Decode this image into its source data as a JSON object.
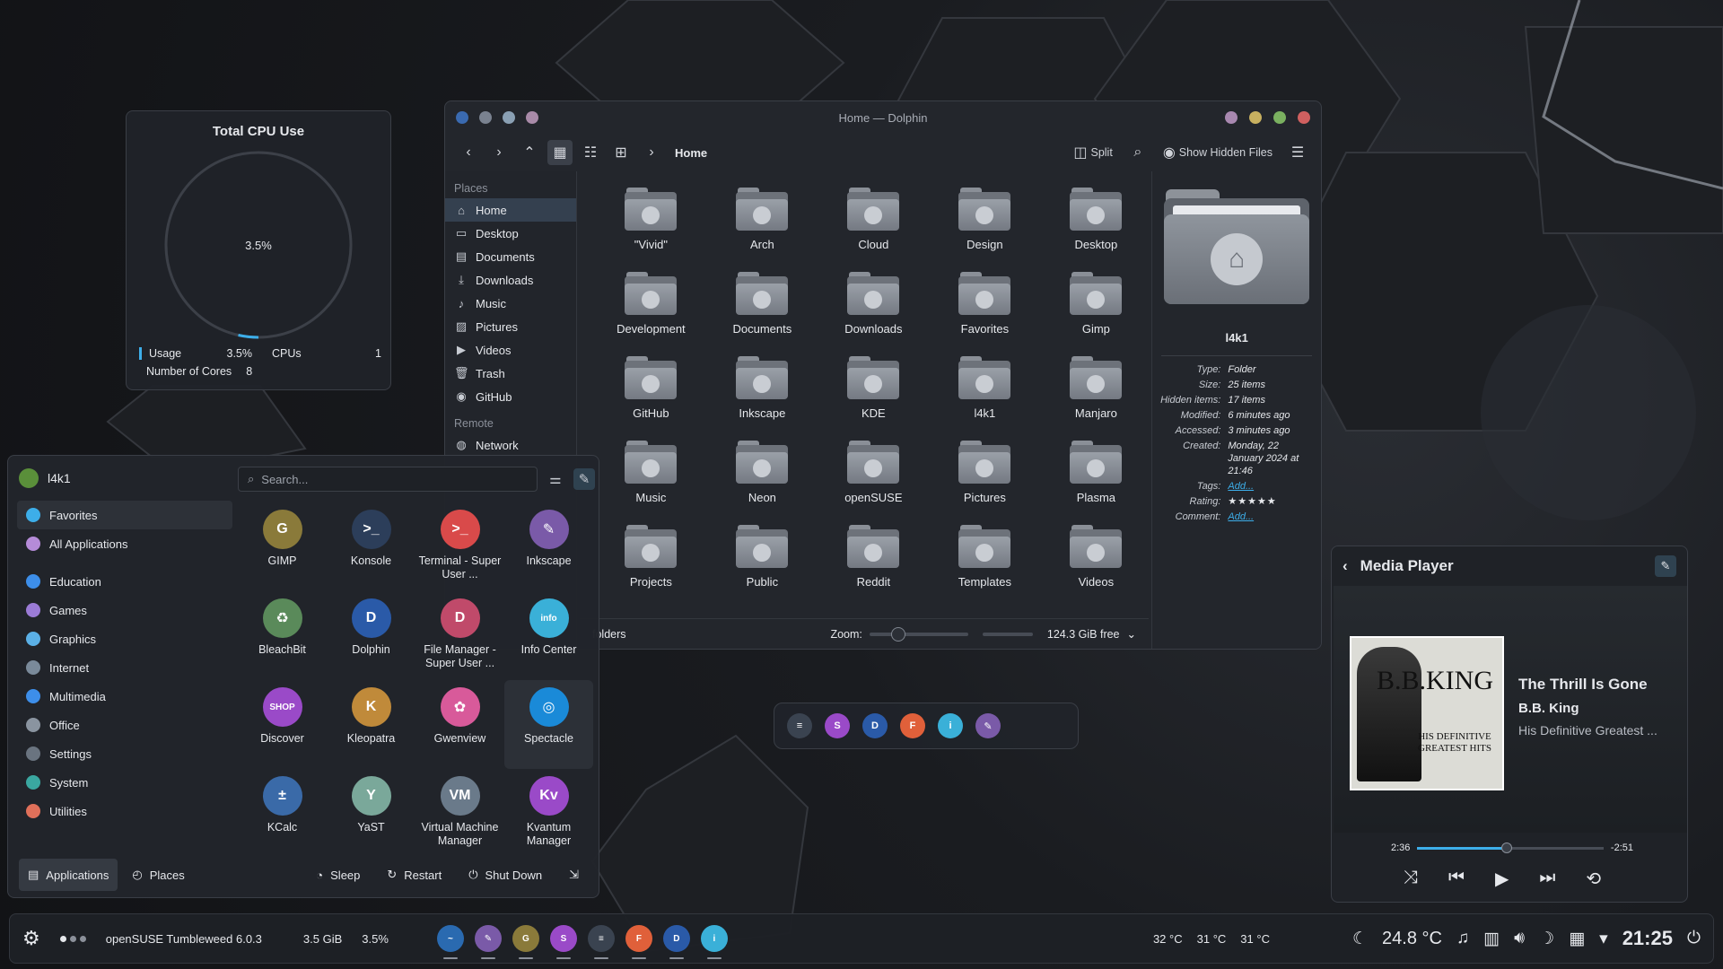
{
  "cpu_widget": {
    "title": "Total CPU Use",
    "percent_label": "3.5%",
    "usage_label": "Usage",
    "usage_value": "3.5%",
    "cpus_label": "CPUs",
    "cpus_value": "1",
    "cores_label": "Number of Cores",
    "cores_value": "8",
    "usage_fraction": 0.035
  },
  "dolphin": {
    "title": "Home — Dolphin",
    "breadcrumb": "Home",
    "split_label": "Split",
    "hidden_files_label": "Show Hidden Files",
    "places_header": "Places",
    "remote_header": "Remote",
    "places": [
      {
        "label": "Home",
        "icon": "home-icon"
      },
      {
        "label": "Desktop",
        "icon": "desktop-icon"
      },
      {
        "label": "Documents",
        "icon": "documents-icon"
      },
      {
        "label": "Downloads",
        "icon": "downloads-icon"
      },
      {
        "label": "Music",
        "icon": "music-icon"
      },
      {
        "label": "Pictures",
        "icon": "pictures-icon"
      },
      {
        "label": "Videos",
        "icon": "videos-icon"
      },
      {
        "label": "Trash",
        "icon": "trash-icon"
      },
      {
        "label": "GitHub",
        "icon": "github-icon"
      }
    ],
    "remote": [
      {
        "label": "Network",
        "icon": "network-icon"
      }
    ],
    "folders": [
      "\"Vivid\"",
      "Arch",
      "Cloud",
      "Design",
      "Desktop",
      "Development",
      "Documents",
      "Downloads",
      "Favorites",
      "Gimp",
      "GitHub",
      "Inkscape",
      "KDE",
      "l4k1",
      "Manjaro",
      "Music",
      "Neon",
      "openSUSE",
      "Pictures",
      "Plasma",
      "Projects",
      "Public",
      "Reddit",
      "Templates",
      "Videos"
    ],
    "status_text": "folders",
    "zoom_label": "Zoom:",
    "free_space": "124.3 GiB free",
    "info": {
      "name": "l4k1",
      "rows": [
        {
          "k": "Type:",
          "v": "Folder"
        },
        {
          "k": "Size:",
          "v": "25 items"
        },
        {
          "k": "Hidden items:",
          "v": "17 items"
        },
        {
          "k": "Modified:",
          "v": "6 minutes ago"
        },
        {
          "k": "Accessed:",
          "v": "3 minutes ago"
        },
        {
          "k": "Created:",
          "v": "Monday, 22 January 2024 at 21:46"
        }
      ],
      "tags_label": "Tags:",
      "tags_value": "Add...",
      "rating_label": "Rating:",
      "rating_value": 5,
      "comment_label": "Comment:",
      "comment_value": "Add..."
    }
  },
  "launcher": {
    "user": "l4k1",
    "search_placeholder": "Search...",
    "categories": [
      {
        "label": "Favorites",
        "color": "#3daee9"
      },
      {
        "label": "All Applications",
        "color": "#b58bd8"
      },
      {
        "label": "Education",
        "color": "#3d8ee9"
      },
      {
        "label": "Games",
        "color": "#9b7bd6"
      },
      {
        "label": "Graphics",
        "color": "#5bb0e6"
      },
      {
        "label": "Internet",
        "color": "#7a8a9a"
      },
      {
        "label": "Multimedia",
        "color": "#3d8ee9"
      },
      {
        "label": "Office",
        "color": "#8a94a0"
      },
      {
        "label": "Settings",
        "color": "#6a7480"
      },
      {
        "label": "System",
        "color": "#3aa7a0"
      },
      {
        "label": "Utilities",
        "color": "#e0705a"
      }
    ],
    "apps": [
      {
        "name": "GIMP",
        "color": "#8a7a3a",
        "glyph": "G"
      },
      {
        "name": "Konsole",
        "color": "#2c3e5a",
        "glyph": ">_"
      },
      {
        "name": "Terminal - Super User ...",
        "color": "#d94a4a",
        "glyph": ">_"
      },
      {
        "name": "Inkscape",
        "color": "#7a5aa8",
        "glyph": "✎"
      },
      {
        "name": "BleachBit",
        "color": "#5a8a5a",
        "glyph": "♻"
      },
      {
        "name": "Dolphin",
        "color": "#2a5aa8",
        "glyph": "D"
      },
      {
        "name": "File Manager - Super User ...",
        "color": "#c04a6a",
        "glyph": "D"
      },
      {
        "name": "Info Center",
        "color": "#3ab0d8",
        "glyph": "info"
      },
      {
        "name": "Discover",
        "color": "#9a4ac8",
        "glyph": "SHOP"
      },
      {
        "name": "Kleopatra",
        "color": "#c08a3a",
        "glyph": "K"
      },
      {
        "name": "Gwenview",
        "color": "#d85a9a",
        "glyph": "✿"
      },
      {
        "name": "Spectacle",
        "color": "#1a8ad8",
        "glyph": "◎"
      },
      {
        "name": "KCalc",
        "color": "#3a6aa8",
        "glyph": "±"
      },
      {
        "name": "YaST",
        "color": "#7aa89a",
        "glyph": "Y"
      },
      {
        "name": "Virtual Machine Manager",
        "color": "#6a7a8a",
        "glyph": "VM"
      },
      {
        "name": "Kvantum Manager",
        "color": "#9a4ac8",
        "glyph": "Kv"
      }
    ],
    "bottom": {
      "applications": "Applications",
      "places": "Places",
      "sleep": "Sleep",
      "restart": "Restart",
      "shutdown": "Shut Down"
    }
  },
  "dock": {
    "icons": [
      {
        "name": "settings-icon",
        "color": "#3a4350",
        "glyph": "≡"
      },
      {
        "name": "discover-icon",
        "color": "#9a4ac8",
        "glyph": "S"
      },
      {
        "name": "dolphin-icon",
        "color": "#2a5aa8",
        "glyph": "D"
      },
      {
        "name": "firefox-icon",
        "color": "#e0603a",
        "glyph": "F"
      },
      {
        "name": "info-center-icon",
        "color": "#3ab0d8",
        "glyph": "i"
      },
      {
        "name": "inkscape-icon",
        "color": "#7a5aa8",
        "glyph": "✎"
      }
    ]
  },
  "media_player": {
    "title": "Media Player",
    "track": "The Thrill Is Gone",
    "artist": "B.B. King",
    "album": "His Definitive Greatest ...",
    "cover_title": "B.B.KING",
    "cover_subtitle": "HIS DEFINITIVE GREATEST HITS",
    "elapsed": "2:36",
    "remaining": "-2:51",
    "progress_fraction": 0.48
  },
  "taskbar": {
    "os_label": "openSUSE Tumbleweed 6.0.3",
    "mem": "3.5 GiB",
    "cpu": "3.5%",
    "temps": [
      "32 °C",
      "31 °C",
      "31 °C"
    ],
    "weather": "24.8 °C",
    "clock": "21:25",
    "apps": [
      {
        "name": "system-monitor-icon",
        "color": "#2a6ab0",
        "glyph": "~"
      },
      {
        "name": "inkscape-icon",
        "color": "#7a5aa8",
        "glyph": "✎"
      },
      {
        "name": "gimp-icon",
        "color": "#8a7a3a",
        "glyph": "G"
      },
      {
        "name": "discover-icon",
        "color": "#9a4ac8",
        "glyph": "S"
      },
      {
        "name": "settings-icon",
        "color": "#3a4350",
        "glyph": "≡"
      },
      {
        "name": "firefox-icon",
        "color": "#e0603a",
        "glyph": "F"
      },
      {
        "name": "dolphin-icon",
        "color": "#2a5aa8",
        "glyph": "D"
      },
      {
        "name": "info-center-icon",
        "color": "#3ab0d8",
        "glyph": "i"
      }
    ]
  }
}
